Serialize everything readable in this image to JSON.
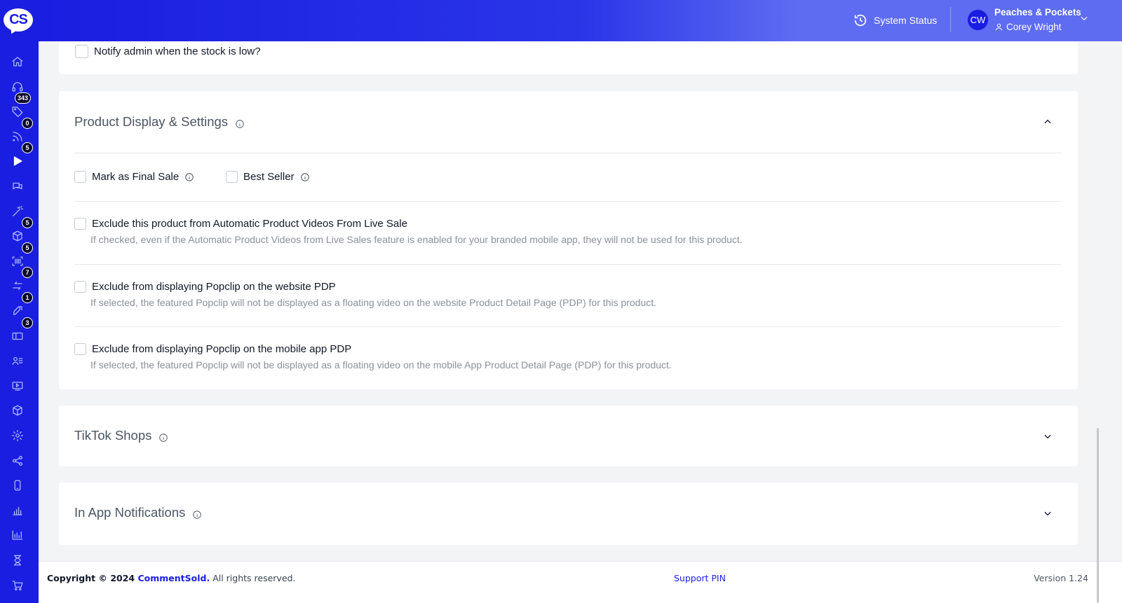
{
  "logo": {
    "text": "CS"
  },
  "sidebar": {
    "items": [
      {
        "name": "home-icon",
        "badge": null
      },
      {
        "name": "headset-icon",
        "badge": null
      },
      {
        "name": "tag-icon",
        "badge": "343"
      },
      {
        "name": "feed-icon",
        "badge": "0"
      },
      {
        "name": "play-icon",
        "badge": "5"
      },
      {
        "name": "chat-icon",
        "badge": null
      },
      {
        "name": "magic-wand-icon",
        "badge": null
      },
      {
        "name": "box-icon",
        "badge": "5"
      },
      {
        "name": "barcode-scan-icon",
        "badge": "5"
      },
      {
        "name": "return-icon",
        "badge": "7"
      },
      {
        "name": "rocket-icon",
        "badge": "1"
      },
      {
        "name": "ticket-icon",
        "badge": "3"
      },
      {
        "name": "customers-icon",
        "badge": null
      },
      {
        "name": "video-icon",
        "badge": null
      },
      {
        "name": "package-icon",
        "badge": null
      },
      {
        "name": "settings-icon",
        "badge": null
      },
      {
        "name": "share-icon",
        "badge": null
      },
      {
        "name": "mobile-icon",
        "badge": null
      },
      {
        "name": "bar-chart-icon",
        "badge": null
      },
      {
        "name": "analytics-icon",
        "badge": null
      },
      {
        "name": "hourglass-icon",
        "badge": null
      },
      {
        "name": "cart-icon",
        "badge": null
      }
    ]
  },
  "header": {
    "system_status": "System Status",
    "avatar_initials": "CW",
    "store_name": "Peaches & Pockets",
    "user_name": "Corey Wright"
  },
  "inventory": {
    "notify_low_stock": "Notify admin when the stock is low?"
  },
  "product_display": {
    "title": "Product Display & Settings",
    "final_sale": "Mark as Final Sale",
    "best_seller": "Best Seller",
    "exclude_auto_videos": "Exclude this product from Automatic Product Videos From Live Sale",
    "exclude_auto_videos_desc": "If checked, even if the Automatic Product Videos from Live Sales feature is enabled for your branded mobile app, they will not be used for this product.",
    "exclude_web_popclip": "Exclude from displaying Popclip on the website PDP",
    "exclude_web_popclip_desc": "If selected, the featured Popclip will not be displayed as a floating video on the website Product Detail Page (PDP) for this product.",
    "exclude_app_popclip": "Exclude from displaying Popclip on the mobile app PDP",
    "exclude_app_popclip_desc": "If selected, the featured Popclip will not be displayed as a floating video on the mobile App Product Detail Page (PDP) for this product."
  },
  "tiktok": {
    "title": "TikTok Shops"
  },
  "notifications": {
    "title": "In App Notifications"
  },
  "footer": {
    "copyright_prefix": "Copyright © 2024 ",
    "brand": "CommentSold.",
    "copyright_suffix": " All rights reserved.",
    "support": "Support PIN",
    "version": "Version 1.24"
  },
  "colors": {
    "brand_blue": "#1a1ee0",
    "header_light": "#5e6cf2"
  }
}
